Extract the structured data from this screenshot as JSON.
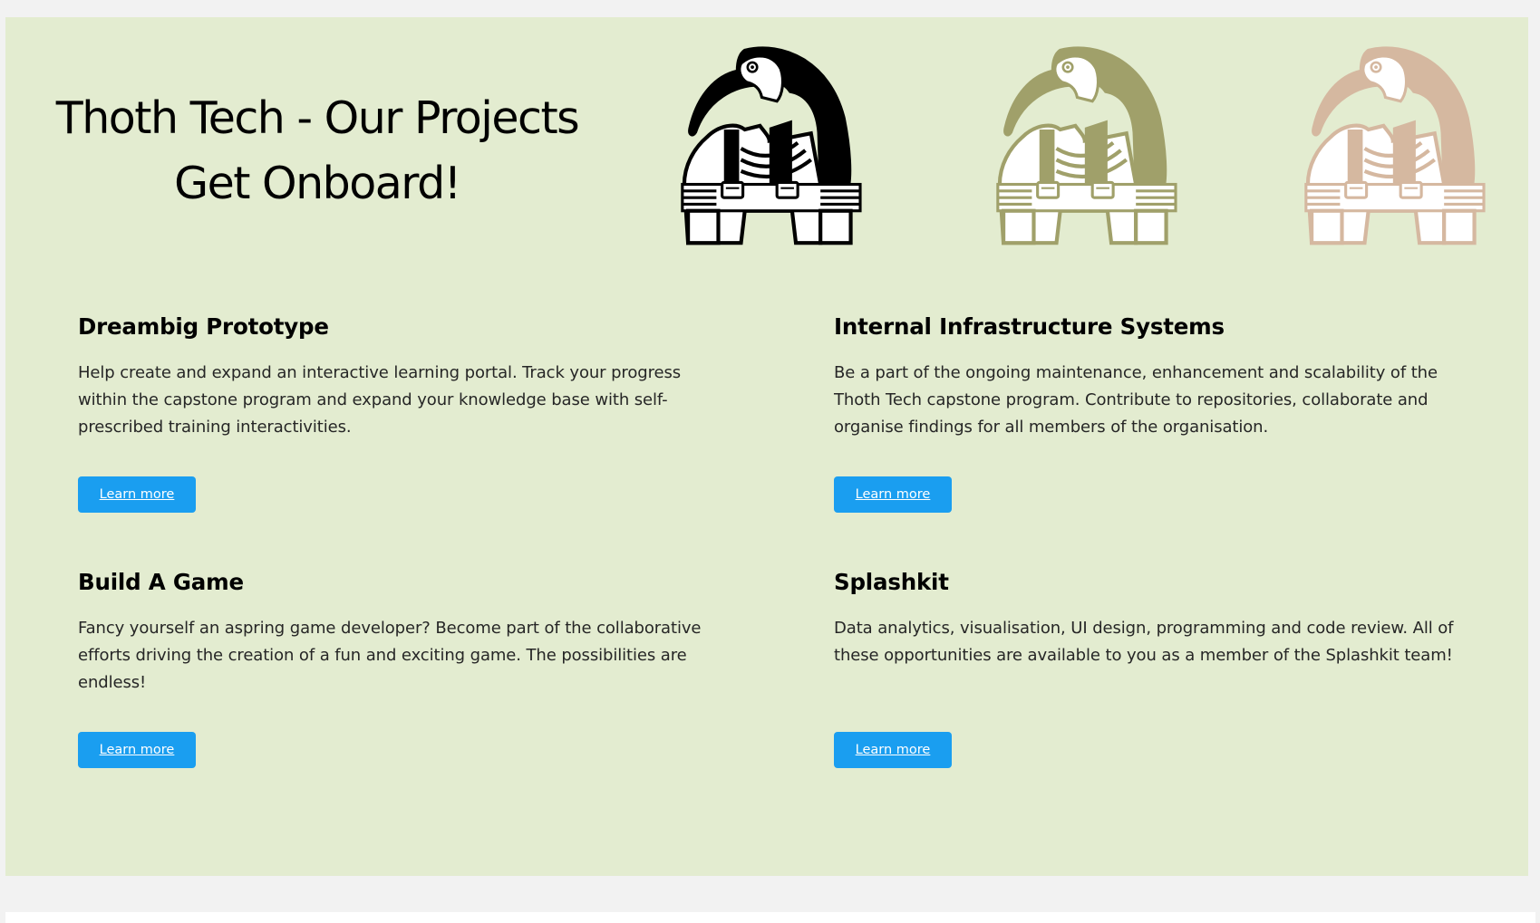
{
  "hero": {
    "title_line1": "Thoth Tech - Our Projects",
    "title_line2": "Get Onboard!"
  },
  "logos": [
    {
      "name": "thoth-logo-black",
      "color": "#000000"
    },
    {
      "name": "thoth-logo-olive",
      "color": "#a0a06a"
    },
    {
      "name": "thoth-logo-tan",
      "color": "#d5b8a0"
    }
  ],
  "colors": {
    "panel_bg": "#e3ecd0",
    "page_bg": "#f2f2f2",
    "button_bg": "#1a9ef0"
  },
  "projects": [
    {
      "title": "Dreambig Prototype",
      "description": "Help create and expand an interactive learning portal. Track your progress within the capstone program and expand your knowledge base with self-prescribed training interactivities.",
      "button_label": "Learn more"
    },
    {
      "title": "Internal Infrastructure Systems",
      "description": "Be a part of the ongoing maintenance, enhancement and scalability of the Thoth Tech capstone program. Contribute to repositories, collaborate and organise findings for all members of the organisation.",
      "button_label": "Learn more"
    },
    {
      "title": "Build A Game",
      "description": "Fancy yourself an aspring game developer? Become part of the collaborative efforts driving the creation of a fun and exciting game. The possibilities are endless!",
      "button_label": "Learn more"
    },
    {
      "title": "Splashkit",
      "description": "Data analytics, visualisation, UI design, programming and code review. All of these opportunities are available to you as a member of the Splashkit team!",
      "button_label": "Learn more"
    }
  ]
}
